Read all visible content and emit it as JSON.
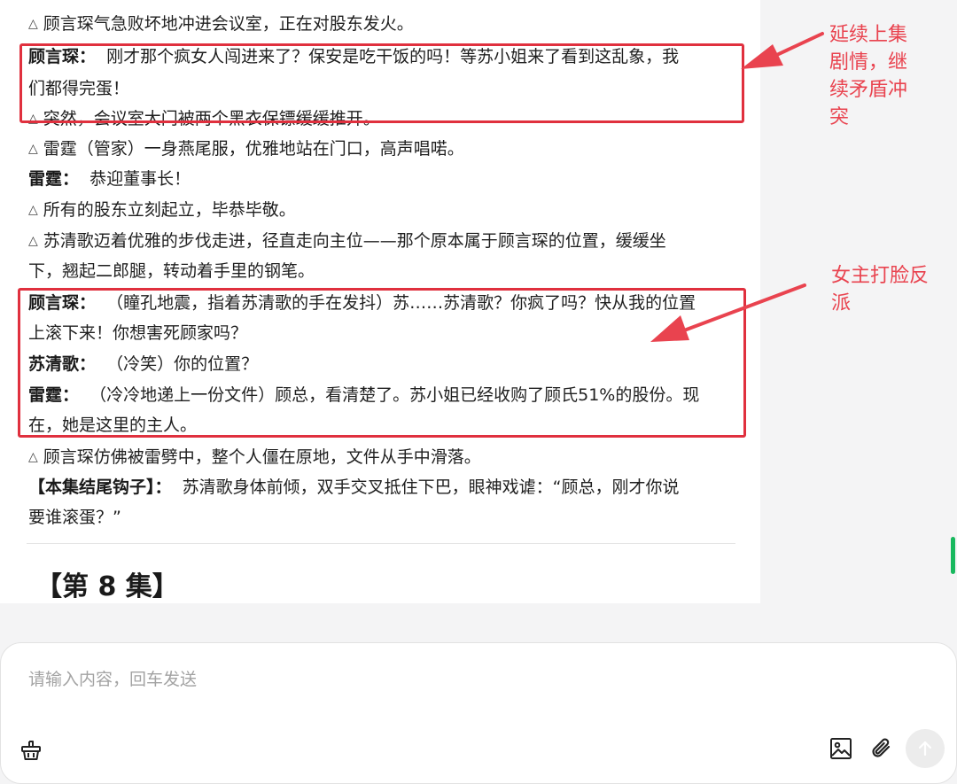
{
  "script": {
    "lines": [
      {
        "speaker": "",
        "text": "顾言琛气急败坏地冲进会议室，正在对股东发火。",
        "action": true
      },
      {
        "speaker": "顾言琛：",
        "text": "刚才那个疯女人闯进来了？保安是吃干饭的吗！等苏小姐来了看到这乱象，我",
        "action": false
      },
      {
        "speaker": "",
        "text": "们都得完蛋！",
        "action": false
      },
      {
        "speaker": "",
        "text": "突然，会议室大门被两个黑衣保镖缓缓推开。",
        "action": true
      },
      {
        "speaker": "",
        "text": "雷霆（管家）一身燕尾服，优雅地站在门口，高声唱喏。",
        "action": true
      },
      {
        "speaker": "雷霆：",
        "text": "恭迎董事长！",
        "action": false
      },
      {
        "speaker": "",
        "text": "所有的股东立刻起立，毕恭毕敬。",
        "action": true
      },
      {
        "speaker": "",
        "text": "苏清歌迈着优雅的步伐走进，径直走向主位——那个原本属于顾言琛的位置，缓缓坐",
        "action": true
      },
      {
        "speaker": "",
        "text": "下，翘起二郎腿，转动着手里的钢笔。",
        "action": false
      },
      {
        "speaker": "顾言琛：",
        "text": "（瞳孔地震，指着苏清歌的手在发抖）苏……苏清歌？你疯了吗？快从我的位置",
        "action": false
      },
      {
        "speaker": "",
        "text": "上滚下来！你想害死顾家吗？",
        "action": false
      },
      {
        "speaker": "苏清歌：",
        "text": "（冷笑）你的位置？",
        "action": false
      },
      {
        "speaker": "雷霆：",
        "text": "（冷冷地递上一份文件）顾总，看清楚了。苏小姐已经收购了顾氏51%的股份。现",
        "action": false
      },
      {
        "speaker": "",
        "text": "在，她是这里的主人。",
        "action": false
      },
      {
        "speaker": "",
        "text": "顾言琛仿佛被雷劈中，整个人僵在原地，文件从手中滑落。",
        "action": true
      },
      {
        "speaker": "【本集结尾钩子】：",
        "text": "苏清歌身体前倾，双手交叉抵住下巴，眼神戏谑：“顾总，刚才你说",
        "action": false
      },
      {
        "speaker": "",
        "text": "要谁滚蛋？”",
        "action": false
      }
    ],
    "triangle_glyph": "△",
    "next_episode_heading": "【第 8 集】"
  },
  "annotations": {
    "note1": [
      "延续上集",
      "剧情，继",
      "续矛盾冲",
      "突"
    ],
    "note2": [
      "女主打脸反",
      "派"
    ],
    "color": "#e0303e"
  },
  "composer": {
    "placeholder": "请输入内容，回车发送",
    "icons": {
      "left": "basket-icon",
      "image": "image-icon",
      "attach": "paperclip-icon",
      "send": "arrow-up-icon"
    }
  },
  "colors": {
    "accent_scroll": "#18b85e",
    "annotation_red": "#e0303e"
  }
}
